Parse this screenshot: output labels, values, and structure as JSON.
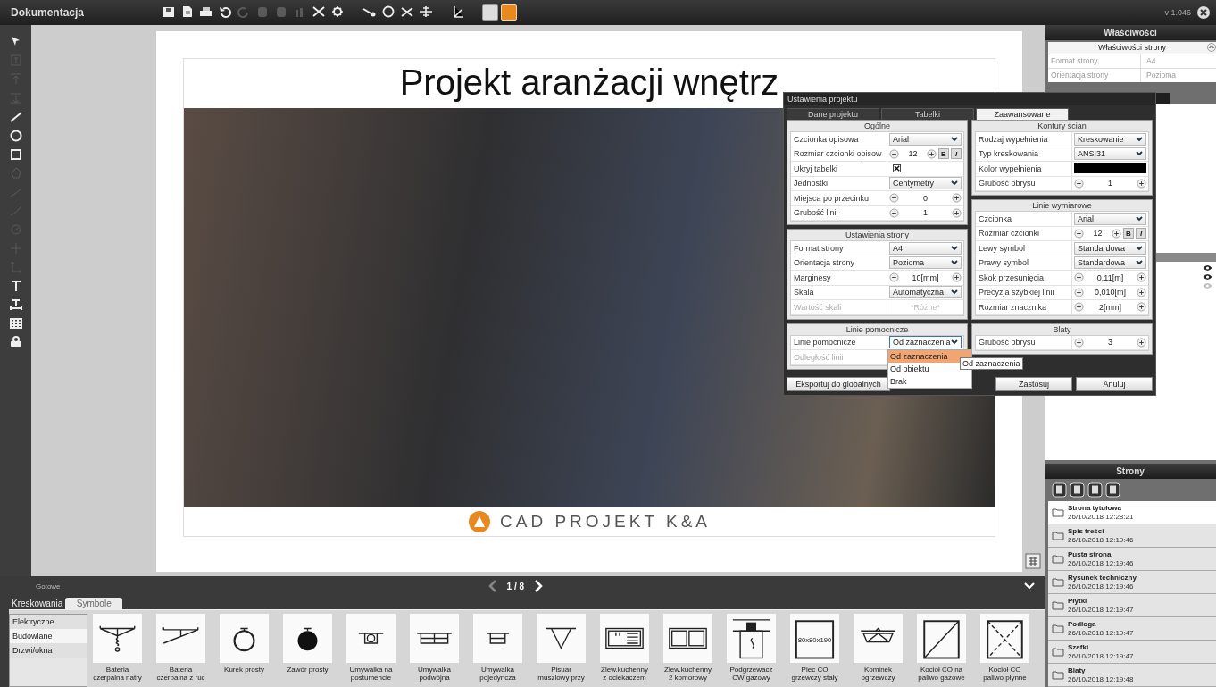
{
  "app": {
    "title": "Dokumentacja",
    "version": "v 1.046"
  },
  "top_toolbar": [
    [
      {
        "kind": "save",
        "disabled": false
      },
      {
        "kind": "page-export",
        "disabled": false
      },
      {
        "kind": "print",
        "disabled": false
      },
      {
        "kind": "undo",
        "disabled": false
      },
      {
        "kind": "redo",
        "disabled": true
      },
      {
        "kind": "page",
        "disabled": true
      },
      {
        "kind": "page",
        "disabled": true
      },
      {
        "kind": "chart",
        "disabled": true
      },
      {
        "kind": "scissors",
        "disabled": false
      },
      {
        "kind": "gear",
        "disabled": false
      }
    ],
    [
      {
        "kind": "slope",
        "disabled": false
      },
      {
        "kind": "circle",
        "disabled": false
      },
      {
        "kind": "cross",
        "disabled": false
      },
      {
        "kind": "axis",
        "disabled": false
      }
    ],
    [
      {
        "kind": "measure",
        "disabled": false
      }
    ]
  ],
  "view_buttons": [
    {
      "selected": false
    },
    {
      "selected": true
    }
  ],
  "left_toolbar": [
    {
      "kind": "pointer",
      "disabled": false
    },
    {
      "kind": "text-frame",
      "disabled": true
    },
    {
      "kind": "align-top",
      "disabled": true
    },
    {
      "kind": "align-bottom",
      "disabled": true
    },
    {
      "kind": "line",
      "disabled": false
    },
    {
      "kind": "circle",
      "disabled": false
    },
    {
      "kind": "square",
      "disabled": false
    },
    {
      "kind": "polygon",
      "disabled": true
    },
    {
      "kind": "polyline",
      "disabled": true
    },
    {
      "kind": "arc",
      "disabled": true
    },
    {
      "kind": "dial",
      "disabled": true
    },
    {
      "kind": "cross",
      "disabled": true
    },
    {
      "kind": "corner",
      "disabled": true
    },
    {
      "kind": "text",
      "disabled": false
    },
    {
      "kind": "dimension",
      "disabled": false
    },
    {
      "kind": "table",
      "disabled": false
    },
    {
      "kind": "stamp",
      "disabled": false
    }
  ],
  "page": {
    "title": "Projekt aranżacji wnętrz",
    "logo_text": "CAD PROJEKT K&A"
  },
  "status": {
    "text": "Gotowe",
    "pager": "1 / 8"
  },
  "dialog": {
    "title": "Ustawienia projektu",
    "tabs": [
      {
        "label": "Dane projektu",
        "selected": false
      },
      {
        "label": "Tabelki",
        "selected": false
      },
      {
        "label": "Zaawansowane",
        "selected": true
      }
    ],
    "left_sections": [
      {
        "title": "Ogólne",
        "rows": [
          {
            "kind": "select",
            "label": "Czcionka opisowa",
            "value": "Arial",
            "disabled": false
          },
          {
            "kind": "spinner",
            "label": "Rozmiar czcionki opisow",
            "value": "12",
            "style_buttons": [
              "B",
              "I"
            ],
            "disabled": false
          },
          {
            "kind": "checkbox",
            "label": "Ukryj tabelki",
            "checked": true,
            "disabled": false
          },
          {
            "kind": "select",
            "label": "Jednostki",
            "value": "Centymetry",
            "disabled": false
          },
          {
            "kind": "spinner",
            "label": "Miejsca po przecinku",
            "value": "0",
            "disabled": false
          },
          {
            "kind": "spinner",
            "label": "Grubość linii",
            "value": "1",
            "disabled": false
          }
        ]
      },
      {
        "title": "Ustawienia strony",
        "rows": [
          {
            "kind": "select",
            "label": "Format strony",
            "value": "A4",
            "disabled": false
          },
          {
            "kind": "select",
            "label": "Orientacja strony",
            "value": "Pozioma",
            "disabled": false
          },
          {
            "kind": "spinner",
            "label": "Marginesy",
            "value": "10[mm]",
            "disabled": false
          },
          {
            "kind": "select",
            "label": "Skala",
            "value": "Automatyczna",
            "disabled": false
          },
          {
            "kind": "readonly",
            "label": "Wartość skali",
            "value": "*Różne*",
            "disabled": true
          }
        ]
      },
      {
        "title": "Linie pomocnicze",
        "rows": [
          {
            "kind": "select",
            "label": "Linie pomocnicze",
            "value": "Od zaznaczenia",
            "disabled": false,
            "expanded": true,
            "options": [
              {
                "label": "Od zaznaczenia",
                "selected": true
              },
              {
                "label": "Od obiektu",
                "selected": false
              },
              {
                "label": "Brak",
                "selected": false
              }
            ]
          },
          {
            "kind": "readonly",
            "label": "Odległość linii",
            "disabled": true
          }
        ]
      }
    ],
    "right_sections": [
      {
        "title": "Kontury ścian",
        "rows": [
          {
            "kind": "select",
            "label": "Rodzaj wypełnienia",
            "value": "Kreskowanie",
            "disabled": false
          },
          {
            "kind": "select",
            "label": "Typ kreskowania",
            "value": "ANSI31",
            "disabled": false
          },
          {
            "kind": "color",
            "label": "Kolor wypełnienia",
            "color": "#000000",
            "disabled": false
          },
          {
            "kind": "spinner",
            "label": "Grubość obrysu",
            "value": "1",
            "disabled": false
          }
        ]
      },
      {
        "title": "Linie wymiarowe",
        "rows": [
          {
            "kind": "select",
            "label": "Czcionka",
            "value": "Arial",
            "disabled": false
          },
          {
            "kind": "spinner",
            "label": "Rozmiar czcionki",
            "value": "12",
            "style_buttons": [
              "B",
              "I"
            ],
            "disabled": false
          },
          {
            "kind": "select",
            "label": "Lewy symbol",
            "value": "Standardowa",
            "disabled": false
          },
          {
            "kind": "select",
            "label": "Prawy symbol",
            "value": "Standardowa",
            "disabled": false
          },
          {
            "kind": "spinner",
            "label": "Skok przesunięcia",
            "value": "0,11[m]",
            "disabled": false
          },
          {
            "kind": "spinner",
            "label": "Precyzja szybkiej linii",
            "value": "0,010[m]",
            "disabled": false
          },
          {
            "kind": "spinner",
            "label": "Rozmiar znacznika",
            "value": "2[mm]",
            "disabled": false
          }
        ]
      },
      {
        "title": "Blaty",
        "rows": [
          {
            "kind": "spinner",
            "label": "Grubość obrysu",
            "value": "3",
            "disabled": false
          }
        ]
      }
    ],
    "tooltip": "Od zaznaczenia",
    "export_button": "Eksportuj do globalnych",
    "buttons": [
      "Zastosuj",
      "Anuluj"
    ]
  },
  "properties": {
    "title": "Właściwości",
    "section": "Właściwości strony",
    "expanded": true,
    "rows": [
      {
        "label": "Format strony",
        "value": "A4"
      },
      {
        "label": "Orientacja strony",
        "value": "Pozioma"
      }
    ]
  },
  "layers": [
    {
      "visible": true
    },
    {
      "visible": true
    },
    {
      "visible": false
    }
  ],
  "pages_panel": {
    "title": "Strony",
    "pages": [
      {
        "name": "Strona tytułowa",
        "date": "26/10/2018 12:28:21",
        "selected": true
      },
      {
        "name": "Spis treści",
        "date": "26/10/2018 12:19:46",
        "selected": false
      },
      {
        "name": "Pusta strona",
        "date": "26/10/2018 12:19:46",
        "selected": false
      },
      {
        "name": "Rysunek techniczny",
        "date": "26/10/2018 12:19:46",
        "selected": false
      },
      {
        "name": "Płytki",
        "date": "26/10/2018 12:19:47",
        "selected": false
      },
      {
        "name": "Podłoga",
        "date": "26/10/2018 12:19:47",
        "selected": false
      },
      {
        "name": "Szafki",
        "date": "26/10/2018 12:19:47",
        "selected": false
      },
      {
        "name": "Blaty",
        "date": "26/10/2018 12:19:48",
        "selected": false
      }
    ]
  },
  "library": {
    "tabs": [
      {
        "label": "Kreskowania",
        "selected": false
      },
      {
        "label": "Symbole",
        "selected": true
      }
    ],
    "categories": [
      {
        "label": "Elektryczne",
        "selected": false
      },
      {
        "label": "Budowlane",
        "selected": true
      },
      {
        "label": "Drzwi/okna",
        "selected": false
      }
    ],
    "symbols": [
      {
        "kind": "tap-spiral",
        "label": "Bateria\nczerpalna natry"
      },
      {
        "kind": "tap-side",
        "label": "Bateria\nczerpalna z ruc"
      },
      {
        "kind": "valve-open",
        "label": "Kurek prosty"
      },
      {
        "kind": "valve-closed",
        "label": "Zawór prosty"
      },
      {
        "kind": "basin-pedestal",
        "label": "Umywalka na\npostumencie"
      },
      {
        "kind": "basin-double",
        "label": "Umywalka\npodwójna"
      },
      {
        "kind": "basin-single",
        "label": "Umywalka\npojedyncza"
      },
      {
        "kind": "urinal",
        "label": "Pisuar\nmuszlowy przy"
      },
      {
        "kind": "sink-drainer",
        "label": "Zlew.kuchenny\nz ociekaczem"
      },
      {
        "kind": "sink-double",
        "label": "Zlew.kuchenny\n2 komorowy"
      },
      {
        "kind": "heater",
        "label": "Podgrzewacz\nCW gazowy"
      },
      {
        "kind": "stove",
        "label": "Piec CO\ngrzewczy stały",
        "inner_text": "80x80x190"
      },
      {
        "kind": "fireplace",
        "label": "Kominek\nogrzewczy"
      },
      {
        "kind": "boiler-gas",
        "label": "Kocioł CO na\npaliwo gazowe"
      },
      {
        "kind": "boiler-oil",
        "label": "Kocioł CO\npaliwo płynne"
      }
    ]
  }
}
